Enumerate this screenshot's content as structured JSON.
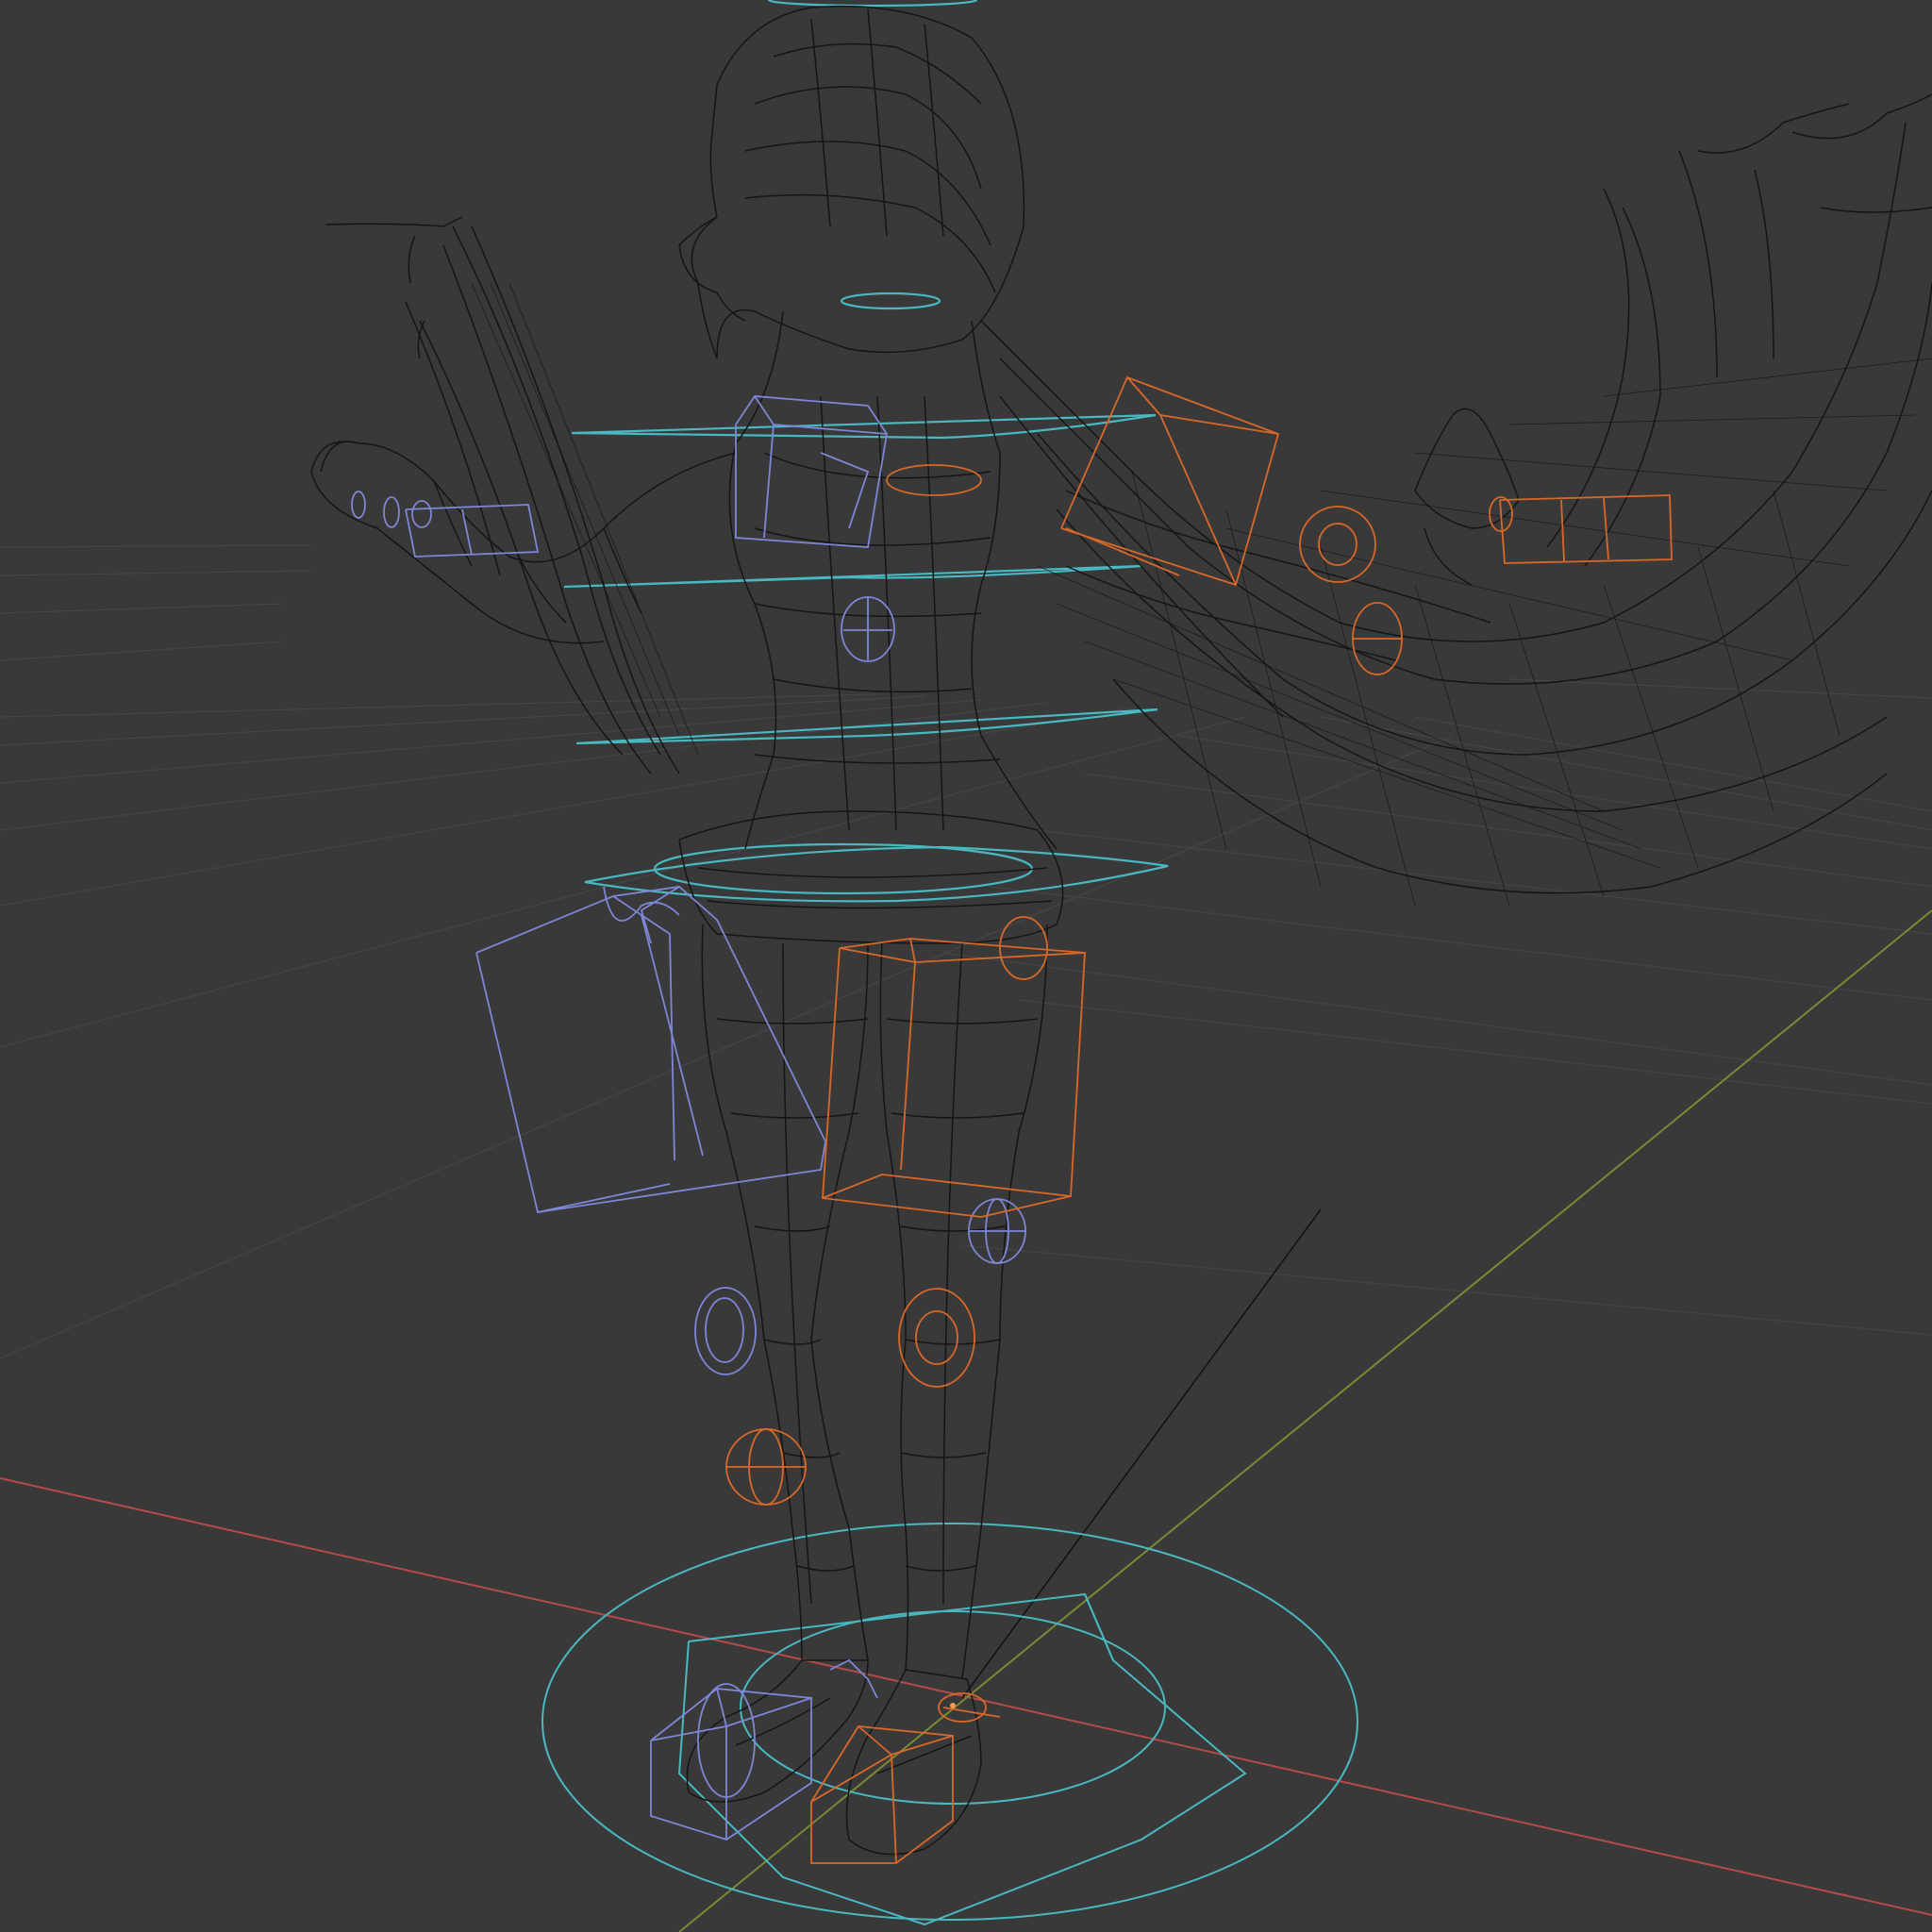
{
  "viewport": {
    "mode": "wireframe",
    "background_color": "#393939",
    "grid_color": "#4a4a4a",
    "axis_x_color": "#b44b4b",
    "axis_y_color": "#7a8a34",
    "mesh_color": "#151515",
    "left_control_color": "#7e86d6",
    "right_control_color": "#d8682a",
    "center_control_color": "#49b8c0"
  }
}
